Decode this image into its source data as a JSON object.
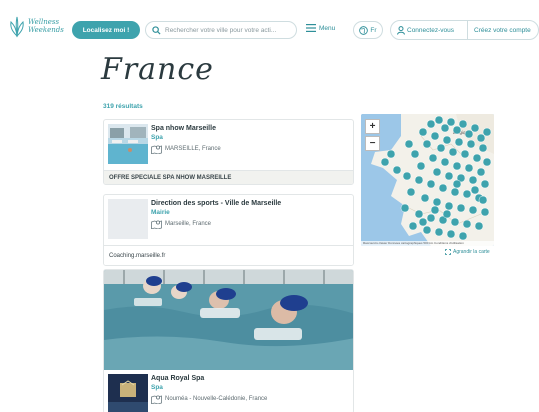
{
  "header": {
    "logo_line1": "Wellness",
    "logo_line2": "Weekends",
    "localize_label": "Localisez moi !",
    "search_placeholder": "Rechercher votre ville pour votre acti...",
    "menu_label": "Menu",
    "lang_label": "Fr",
    "login_label": "Connectez-vous",
    "create_account_label": "Créez votre compte"
  },
  "page": {
    "title": "France",
    "result_count": "319 résultats"
  },
  "results": [
    {
      "name": "Spa nhow Marseille",
      "category": "Spa",
      "location": "MARSEILLE, France",
      "footer": "OFFRE SPECIALE SPA NHOW MASREILLE"
    },
    {
      "name": "Direction des sports - Ville de Marseille",
      "category": "Mairie",
      "location": "Marseille, France",
      "footer": "Coaching.marseille.fr"
    },
    {
      "name": "Aqua Royal Spa",
      "category": "Spa",
      "location": "Nouméa - Nouvelle-Calédonie, France"
    }
  ],
  "map": {
    "zoom_in": "+",
    "zoom_out": "−",
    "attribution": "Raccourcis clavier   Données cartographiques   500 km   Conditions d'utilisation",
    "enlarge_label": "Agrandir la carte",
    "labels": [
      "Belgique",
      "Fr"
    ]
  },
  "colors": {
    "accent": "#3ea3ad",
    "link": "#2e8f99",
    "text": "#2b3a3f",
    "map_water": "#9cc7e8",
    "map_land": "#f3f1ea",
    "pin": "#3ea3ad"
  }
}
